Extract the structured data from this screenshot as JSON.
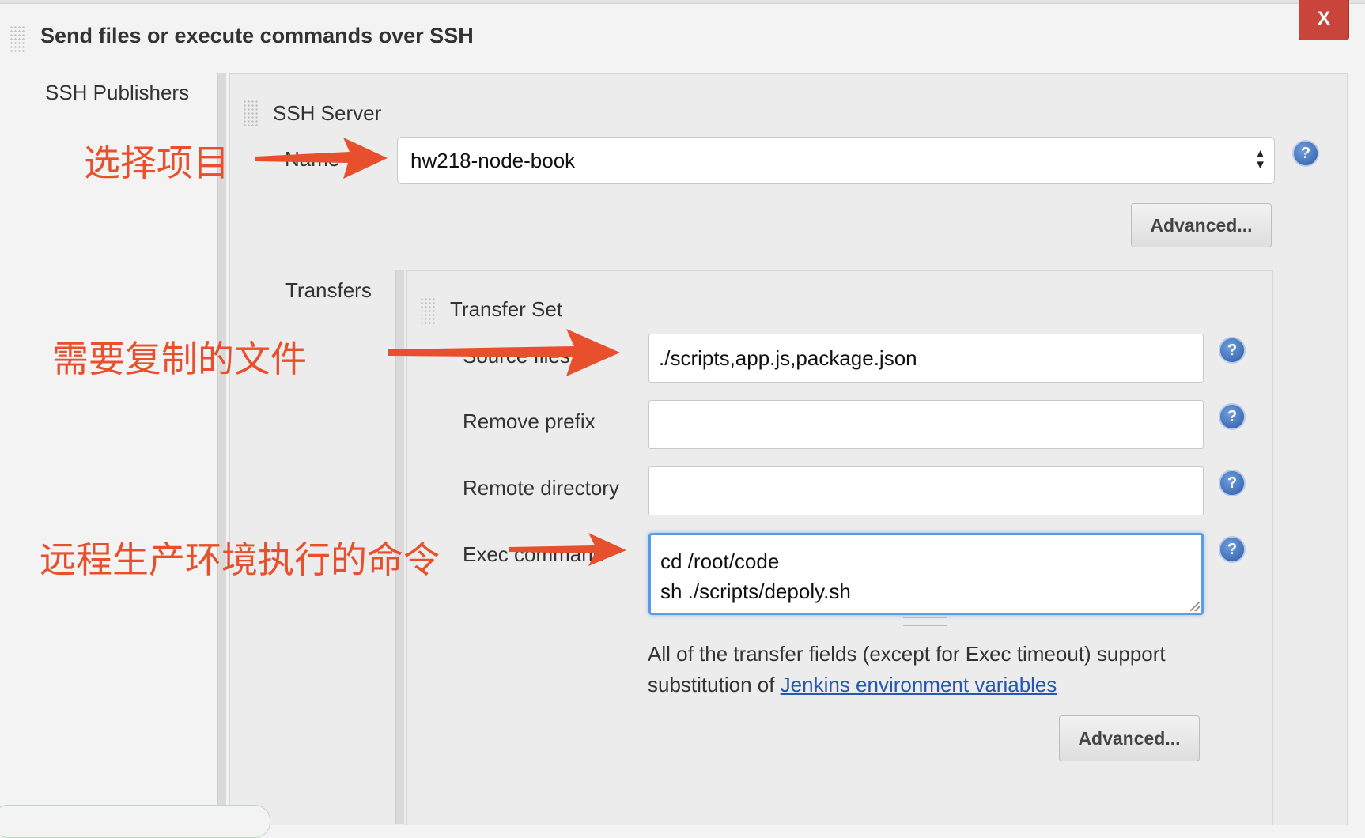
{
  "header": {
    "title": "Send files or execute commands over SSH",
    "close_label": "X"
  },
  "publishers": {
    "label": "SSH Publishers",
    "server": {
      "title": "SSH Server",
      "name_label": "Name",
      "name_value": "hw218-node-book",
      "advanced_label": "Advanced..."
    },
    "transfers": {
      "label": "Transfers",
      "set_title": "Transfer Set",
      "source_files_label": "Source files",
      "source_files_value": "./scripts,app.js,package.json",
      "remove_prefix_label": "Remove prefix",
      "remove_prefix_value": "",
      "remote_directory_label": "Remote directory",
      "remote_directory_value": "",
      "exec_command_label": "Exec command",
      "exec_command_lines": [
        "cd /root/code",
        "sh ./scripts/depoly.sh"
      ],
      "note_text": "All of the transfer fields (except for Exec timeout) support substitution of ",
      "note_link": "Jenkins environment variables",
      "advanced_label": "Advanced..."
    }
  },
  "annotations": {
    "select_project": "选择项目",
    "files_to_copy": "需要复制的文件",
    "remote_command": "远程生产环境执行的命令",
    "color": "#e8502d"
  },
  "help_icon_glyph": "?"
}
